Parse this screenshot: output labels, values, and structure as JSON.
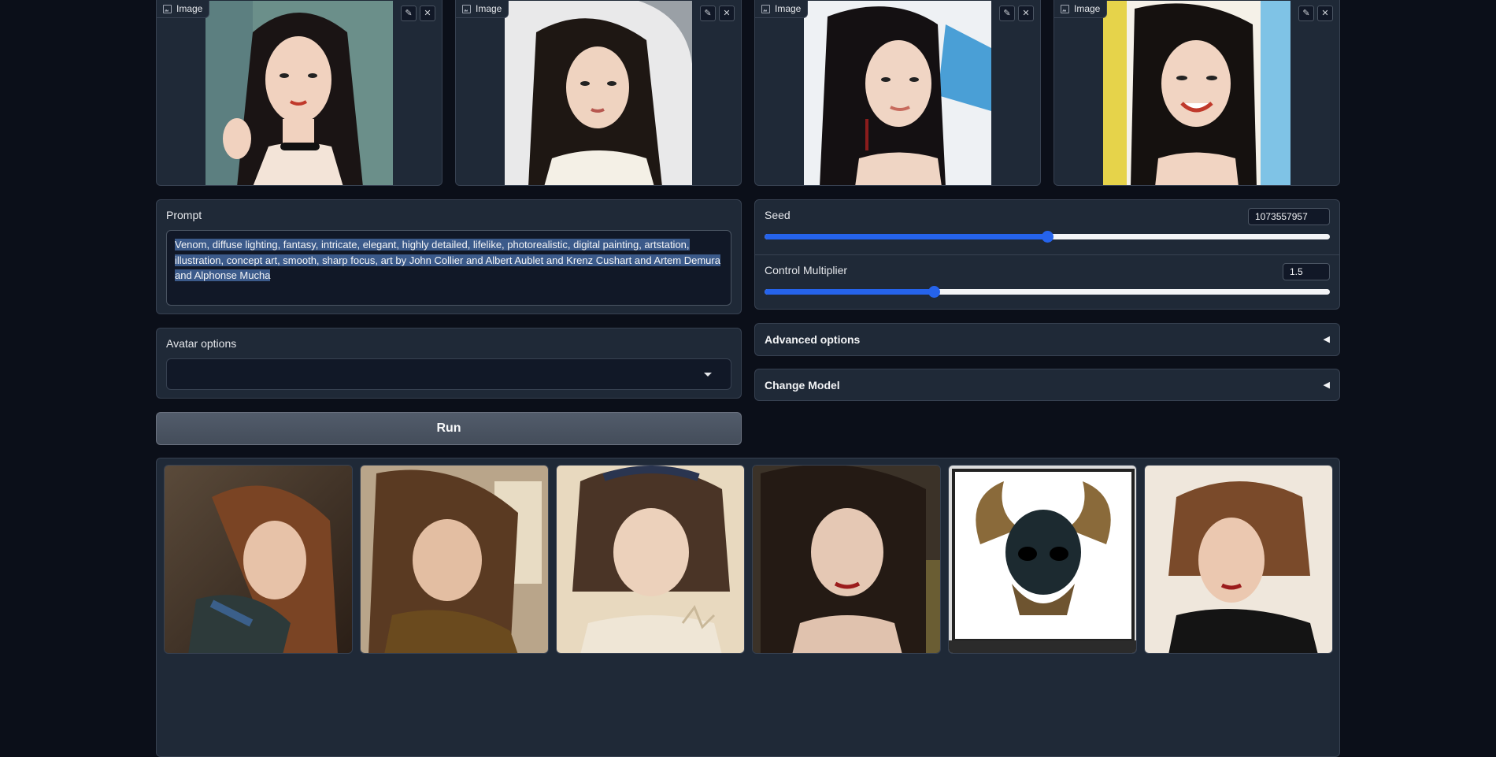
{
  "images": [
    {
      "label": "Image",
      "edit_icon": "pencil-icon",
      "clear_icon": "close-icon"
    },
    {
      "label": "Image",
      "edit_icon": "pencil-icon",
      "clear_icon": "close-icon"
    },
    {
      "label": "Image",
      "edit_icon": "pencil-icon",
      "clear_icon": "close-icon"
    },
    {
      "label": "Image",
      "edit_icon": "pencil-icon",
      "clear_icon": "close-icon"
    }
  ],
  "prompt": {
    "label": "Prompt",
    "value": "Venom, diffuse lighting, fantasy, intricate, elegant, highly detailed, lifelike, photorealistic, digital painting, artstation, illustration, concept art, smooth, sharp focus, art by John Collier and Albert Aublet and Krenz Cushart and Artem Demura and Alphonse Mucha"
  },
  "seed": {
    "label": "Seed",
    "value": "1073557957",
    "fraction": 0.5
  },
  "control_multiplier": {
    "label": "Control Multiplier",
    "value": "1.5",
    "fraction": 0.3
  },
  "avatar_options": {
    "label": "Avatar options",
    "selected": ""
  },
  "run_button": "Run",
  "advanced_options": {
    "label": "Advanced options",
    "caret": "◀"
  },
  "change_model": {
    "label": "Change Model",
    "caret": "◀"
  },
  "colors": {
    "accent": "#2563eb",
    "panel": "#1f2937",
    "background": "#0b0f19"
  }
}
